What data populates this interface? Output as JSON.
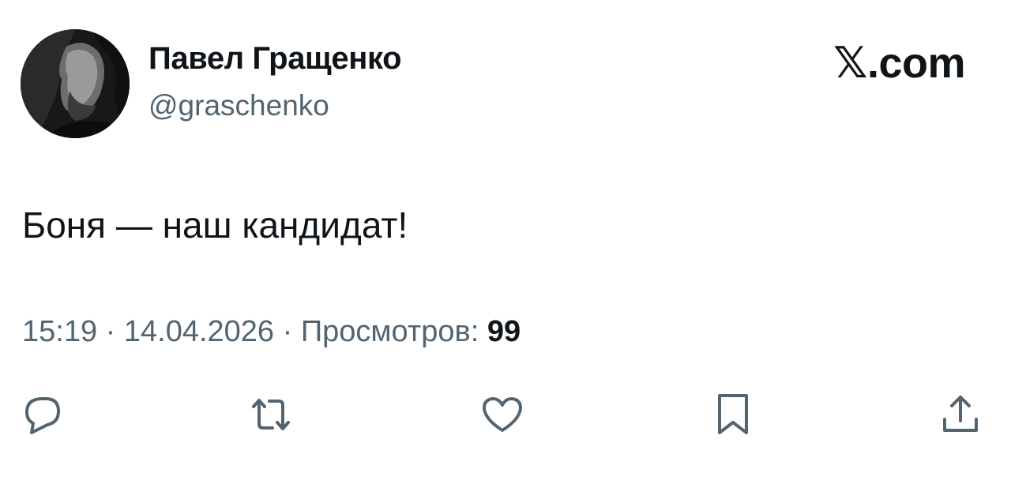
{
  "author": {
    "display_name": "Павел Гращенко",
    "handle": "@graschenko"
  },
  "brand": {
    "label": "𝕏.com"
  },
  "tweet": {
    "text": "Боня — наш кандидат!"
  },
  "meta": {
    "time": "15:19",
    "separator_1": " · ",
    "date": "14.04.2026",
    "separator_2": " · ",
    "views_label": "Просмотров: ",
    "views_count": "99"
  },
  "actions": [
    {
      "icon": "reply-icon"
    },
    {
      "icon": "retweet-icon"
    },
    {
      "icon": "like-icon"
    },
    {
      "icon": "bookmark-icon"
    },
    {
      "icon": "share-icon"
    }
  ],
  "colors": {
    "text_primary": "#0f1419",
    "text_secondary": "#536471",
    "icon": "#536471"
  }
}
